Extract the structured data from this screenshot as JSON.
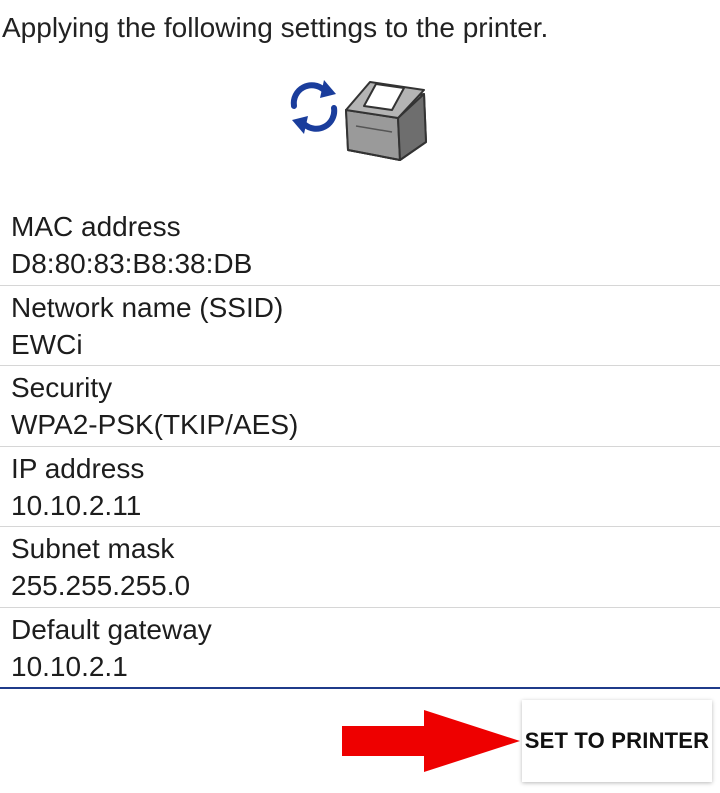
{
  "heading": "Applying the following settings to the printer.",
  "illustration": {
    "sync_icon": "sync-arrows-icon",
    "printer_icon": "receipt-printer-icon",
    "accent_color": "#1a3d9c"
  },
  "settings": [
    {
      "label": "MAC address",
      "value": "D8:80:83:B8:38:DB"
    },
    {
      "label": "Network name (SSID)",
      "value": "EWCi"
    },
    {
      "label": "Security",
      "value": "WPA2-PSK(TKIP/AES)"
    },
    {
      "label": "IP address",
      "value": "10.10.2.11"
    },
    {
      "label": "Subnet mask",
      "value": "255.255.255.0"
    },
    {
      "label": "Default gateway",
      "value": "10.10.2.1"
    }
  ],
  "footer": {
    "arrow_icon": "red-arrow-right-icon",
    "arrow_color": "#ee0000",
    "set_button_label": "SET TO PRINTER"
  }
}
